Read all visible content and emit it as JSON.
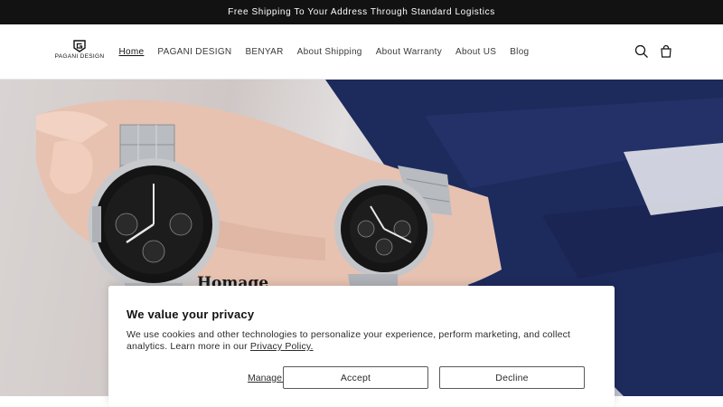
{
  "announcement": {
    "text": "Free Shipping To Your Address Through Standard Logistics"
  },
  "header": {
    "logo_text": "PAGANI DESIGN",
    "nav": [
      {
        "label": "Home",
        "active": true
      },
      {
        "label": "PAGANI DESIGN"
      },
      {
        "label": "BENYAR"
      },
      {
        "label": "About Shipping"
      },
      {
        "label": "About Warranty"
      },
      {
        "label": "About US"
      },
      {
        "label": "Blog"
      }
    ],
    "icons": [
      "search-icon",
      "cart-icon"
    ]
  },
  "hero": {
    "overlay_text": "Homage"
  },
  "consent": {
    "title": "We value your privacy",
    "body_text": "We use cookies and other technologies to personalize your experience, perform marketing, and collect analytics. Learn more in our ",
    "policy_link": "Privacy Policy.",
    "manage_label": "Manage preferences",
    "accept_label": "Accept",
    "decline_label": "Decline"
  }
}
